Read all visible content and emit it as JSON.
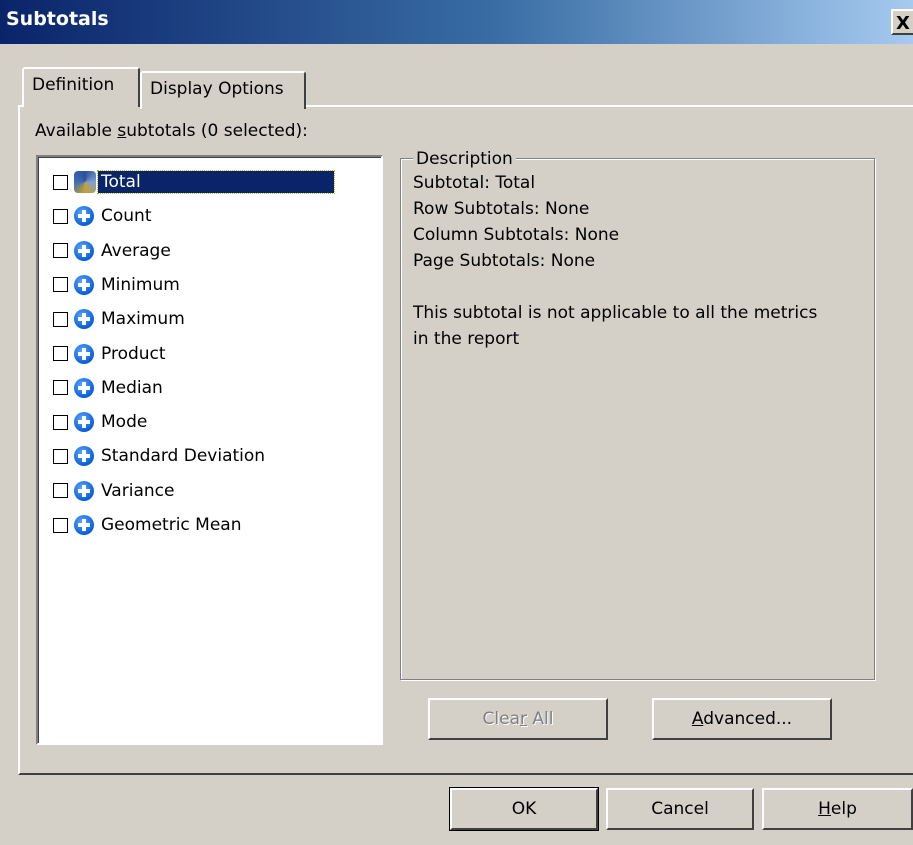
{
  "window": {
    "title": "Subtotals",
    "close_glyph": "X"
  },
  "tabs": [
    {
      "label": "Definition",
      "active": true
    },
    {
      "label": "Display Options",
      "active": false
    }
  ],
  "list": {
    "label_prefix": "Available ",
    "label_mnemonic": "s",
    "label_suffix": "ubtotals (0 selected):",
    "items": [
      {
        "label": "Total",
        "icon": "total-icon",
        "checked": false,
        "selected": true
      },
      {
        "label": "Count",
        "icon": "plus-icon",
        "checked": false
      },
      {
        "label": "Average",
        "icon": "plus-icon",
        "checked": false
      },
      {
        "label": "Minimum",
        "icon": "plus-icon",
        "checked": false
      },
      {
        "label": "Maximum",
        "icon": "plus-icon",
        "checked": false
      },
      {
        "label": "Product",
        "icon": "plus-icon",
        "checked": false
      },
      {
        "label": "Median",
        "icon": "plus-icon",
        "checked": false
      },
      {
        "label": "Mode",
        "icon": "plus-icon",
        "checked": false
      },
      {
        "label": "Standard Deviation",
        "icon": "plus-icon",
        "checked": false
      },
      {
        "label": "Variance",
        "icon": "plus-icon",
        "checked": false
      },
      {
        "label": "Geometric Mean",
        "icon": "plus-icon",
        "checked": false
      }
    ]
  },
  "description": {
    "legend": "Description",
    "lines": [
      "Subtotal: Total",
      "Row Subtotals: None",
      "Column Subtotals: None",
      "Page Subtotals: None",
      "",
      "This subtotal is not applicable to all the metrics",
      "in the report"
    ]
  },
  "buttons": {
    "clear_all_prefix": "Clea",
    "clear_all_mnemonic": "r",
    "clear_all_suffix": " All",
    "advanced_mnemonic": "A",
    "advanced_suffix": "dvanced...",
    "ok": "OK",
    "cancel": "Cancel",
    "help_mnemonic": "H",
    "help_suffix": "elp"
  },
  "colors": {
    "dialog_bg": "#d4d0c8",
    "titlebar_start": "#0a246a",
    "titlebar_end": "#a6caf0",
    "selection_bg": "#0a246a"
  }
}
